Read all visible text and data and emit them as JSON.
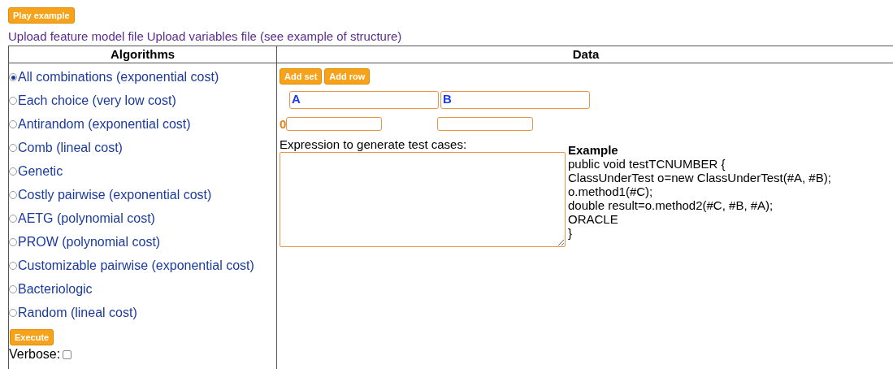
{
  "play_button": "Play example",
  "links": [
    "Upload feature model file",
    "Upload variables file (see example of structure)"
  ],
  "table": {
    "columns": [
      "Algorithms",
      "Data"
    ]
  },
  "algorithms": [
    {
      "label": "All combinations (exponential cost)",
      "selected": true
    },
    {
      "label": "Each choice (very low cost)",
      "selected": false
    },
    {
      "label": "Antirandom (exponential cost)",
      "selected": false
    },
    {
      "label": "Comb (lineal cost)",
      "selected": false
    },
    {
      "label": "Genetic",
      "selected": false
    },
    {
      "label": "Costly pairwise (exponential cost)",
      "selected": false
    },
    {
      "label": "AETG (polynomial cost)",
      "selected": false
    },
    {
      "label": "PROW (polynomial cost)",
      "selected": false
    },
    {
      "label": "Customizable pairwise (exponential cost)",
      "selected": false
    },
    {
      "label": "Bacteriologic",
      "selected": false
    },
    {
      "label": "Random (lineal cost)",
      "selected": false
    }
  ],
  "execute_button": "Execute",
  "verbose": {
    "label": "Verbose:",
    "checked": false
  },
  "data_buttons": [
    "Add set",
    "Add row"
  ],
  "sets": [
    "A",
    "B"
  ],
  "rows": [
    {
      "index": "0",
      "fields": [
        {
          "kind": "input"
        },
        {
          "kind": "input"
        }
      ]
    }
  ],
  "expression_label": "Expression to generate test cases:",
  "example": {
    "title": "Example",
    "lines": [
      "public void testTCNUMBER {",
      "ClassUnderTest o=new ClassUnderTest(#A, #B);",
      "o.method1(#C);",
      "double result=o.method2(#C, #B, #A);",
      "ORACLE",
      "}"
    ]
  }
}
